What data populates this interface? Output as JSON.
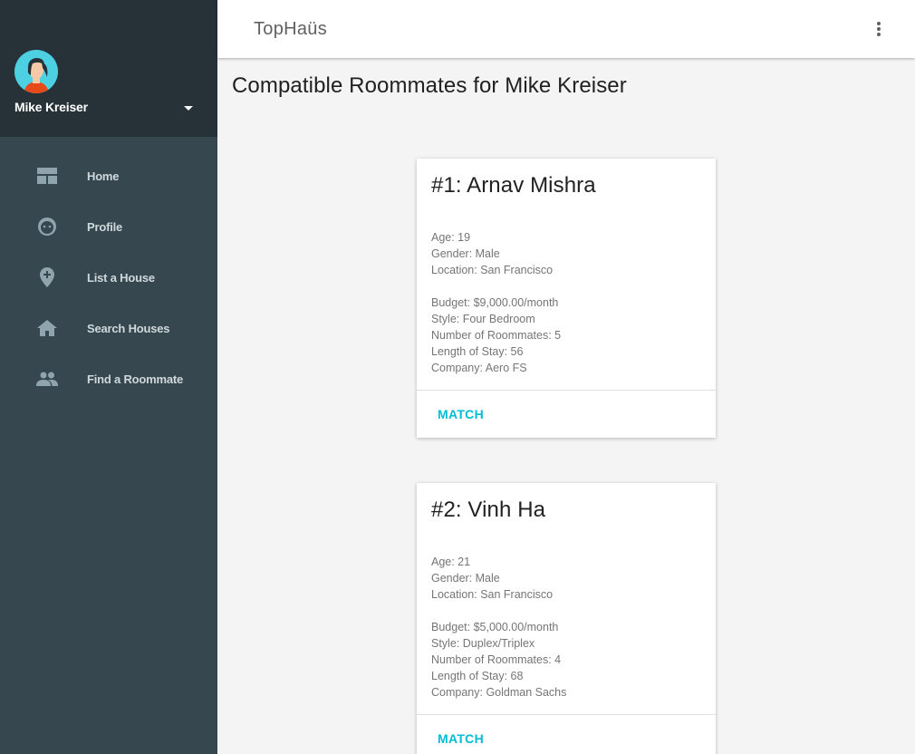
{
  "sidebar": {
    "user_name": "Mike Kreiser",
    "items": [
      {
        "label": "Home",
        "icon": "dashboard-icon"
      },
      {
        "label": "Profile",
        "icon": "face-icon"
      },
      {
        "label": "List a House",
        "icon": "add-location-icon"
      },
      {
        "label": "Search Houses",
        "icon": "home-icon"
      },
      {
        "label": "Find a Roommate",
        "icon": "people-icon"
      }
    ]
  },
  "topbar": {
    "title": "TopHaüs"
  },
  "main": {
    "page_title": "Compatible Roommates for Mike Kreiser",
    "cards": [
      {
        "title": "#1: Arnav Mishra",
        "age": "Age: 19",
        "gender": "Gender: Male",
        "location": "Location: San Francisco",
        "budget": "Budget: $9,000.00/month",
        "style": "Style: Four Bedroom",
        "roommates": "Number of Roommates: 5",
        "stay": "Length of Stay: 56",
        "company": "Company: Aero FS",
        "action": "MATCH"
      },
      {
        "title": "#2: Vinh Ha",
        "age": "Age: 21",
        "gender": "Gender: Male",
        "location": "Location: San Francisco",
        "budget": "Budget: $5,000.00/month",
        "style": "Style: Duplex/Triplex",
        "roommates": "Number of Roommates: 4",
        "stay": "Length of Stay: 68",
        "company": "Company: Goldman Sachs",
        "action": "MATCH"
      }
    ]
  },
  "colors": {
    "sidebar_bg": "#37474f",
    "sidebar_header_bg": "#263238",
    "accent": "#00bcd4",
    "nav_text": "#cfd8dc",
    "nav_icon": "#90a4ae"
  }
}
